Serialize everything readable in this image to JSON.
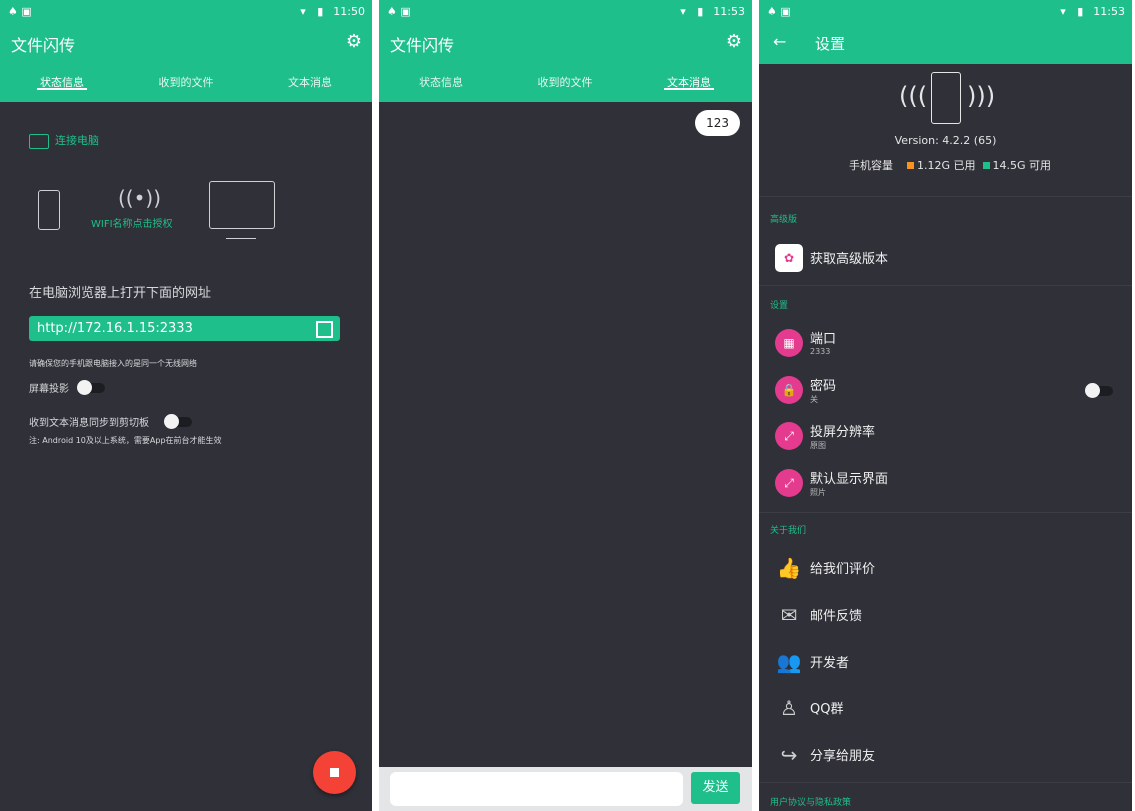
{
  "screen1": {
    "status_left_icons": "♠ ▣",
    "status_right": "11:50",
    "title": "文件闪传",
    "tabs": [
      "状态信息",
      "收到的文件",
      "文本消息"
    ],
    "connect_label": "连接电脑",
    "wifi_label": "WIFI名称点击授权",
    "open_url_heading": "在电脑浏览器上打开下面的网址",
    "url": "http://172.16.1.15:2333",
    "network_note": "请确保您的手机跟电脑接入的是同一个无线网络",
    "screen_cast_label": "屏幕投影",
    "sync_clipboard_label": "收到文本消息同步到剪切板",
    "android_note": "注: Android 10及以上系统，需要App在前台才能生效"
  },
  "screen2": {
    "status_right": "11:53",
    "title": "文件闪传",
    "tabs": [
      "状态信息",
      "收到的文件",
      "文本消息"
    ],
    "message": "123",
    "input_placeholder": "",
    "send_label": "发送"
  },
  "screen3": {
    "status_right": "11:53",
    "title": "设置",
    "version": "Version: 4.2.2 (65)",
    "storage_label": "手机容量",
    "used": "1.12G 已用",
    "available": "14.5G 可用",
    "sections": {
      "premium": "高级版",
      "settings": "设置",
      "about": "关于我们",
      "privacy": "用户协议与隐私政策"
    },
    "premium_item": "获取高级版本",
    "port": {
      "label": "端口",
      "value": "2333"
    },
    "password": {
      "label": "密码",
      "value": "关"
    },
    "resolution": {
      "label": "投屏分辨率",
      "value": "原图"
    },
    "default_view": {
      "label": "默认显示界面",
      "value": "照片"
    },
    "about_items": [
      "给我们评价",
      "邮件反馈",
      "开发者",
      "QQ群",
      "分享给朋友"
    ]
  },
  "colors": {
    "accent": "#1ebf8a",
    "background": "#2f3038",
    "fab": "#f44336",
    "settings_icon": "#e43b8f"
  }
}
